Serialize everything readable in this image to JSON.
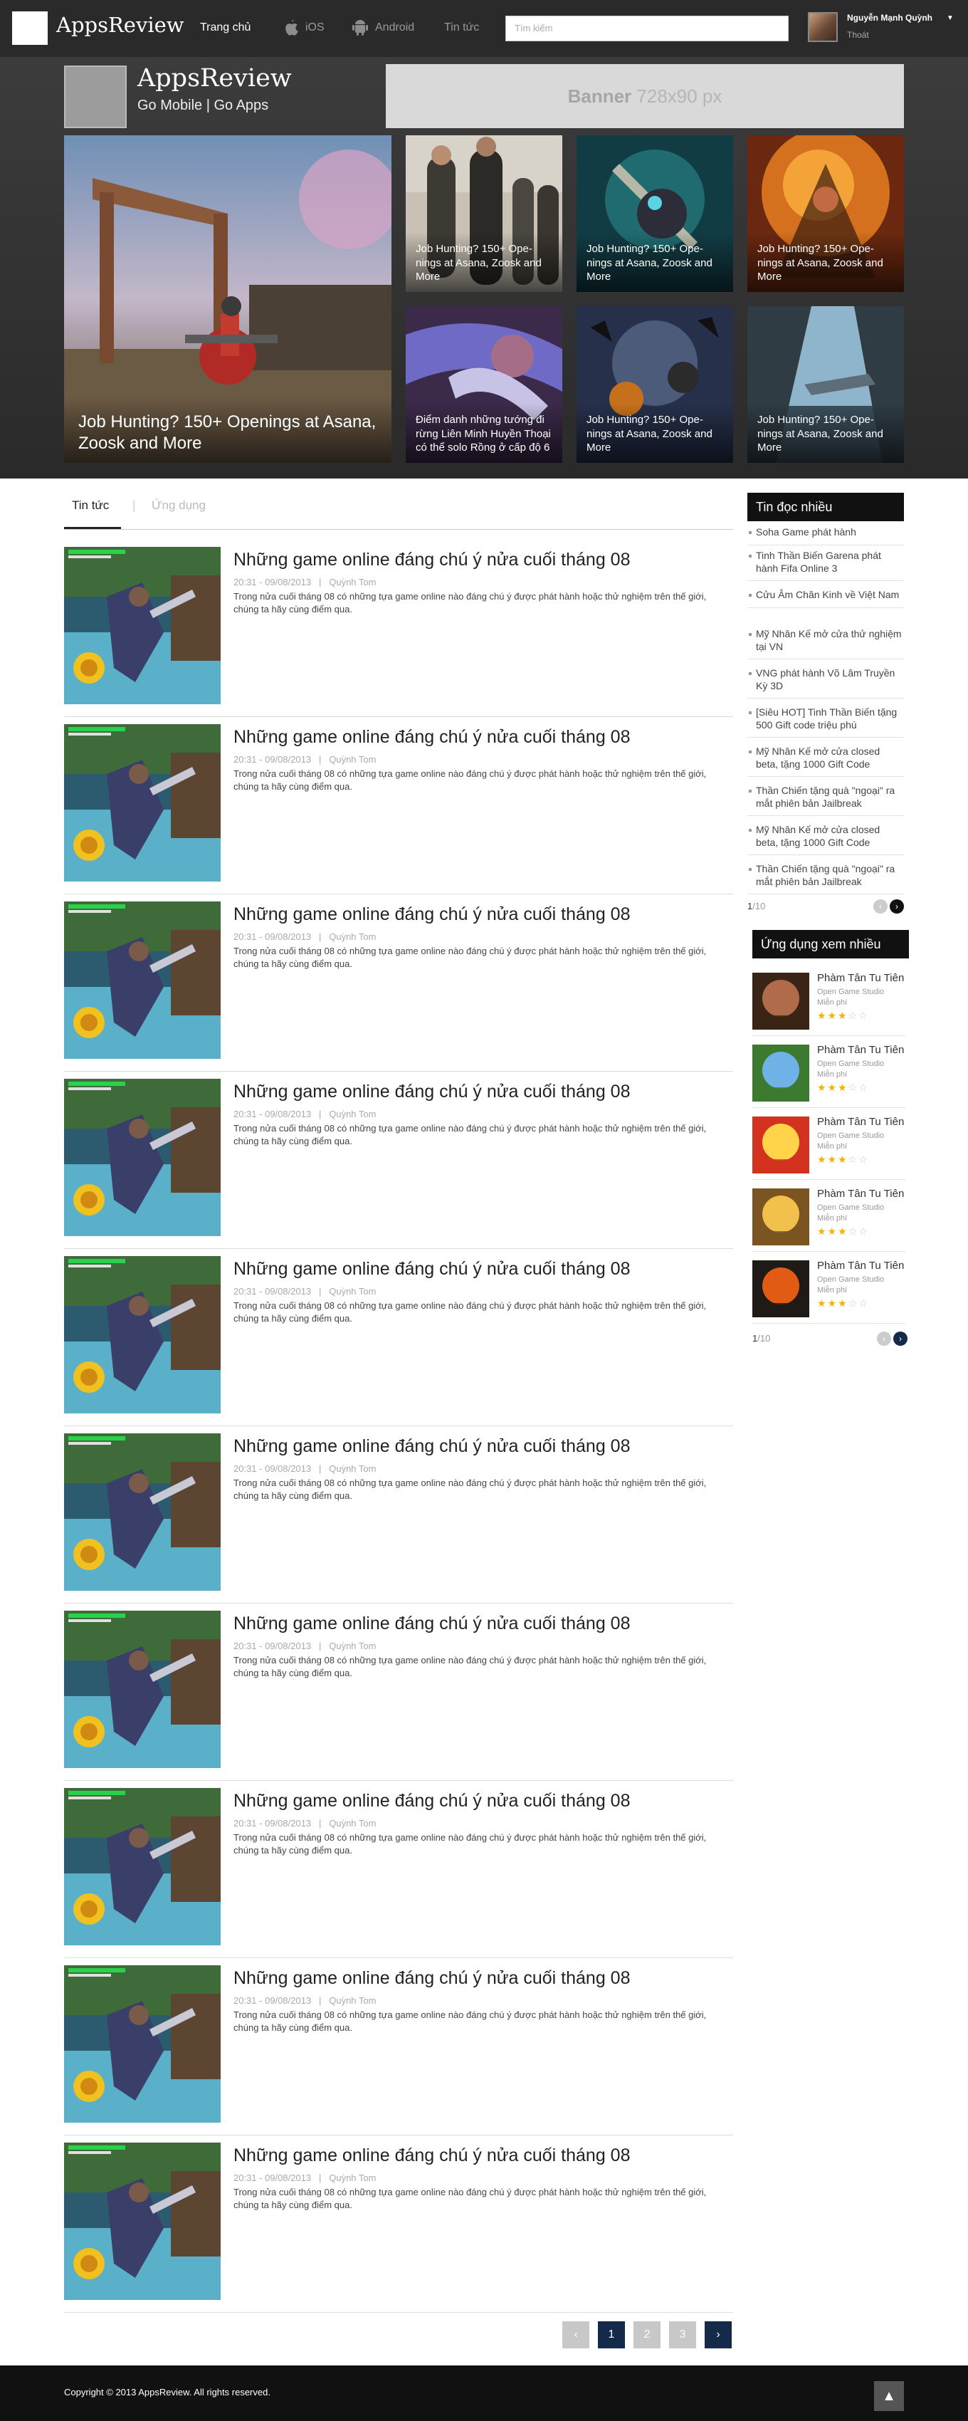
{
  "nav": {
    "logo": "AppsReview",
    "items": [
      "Trang chủ",
      "iOS",
      "Android",
      "Tin tức"
    ],
    "search_placeholder": "Tìm kiếm",
    "user_name": "Nguyễn Mạnh Quỳnh",
    "logout": "Thoát"
  },
  "hero": {
    "site_title": "AppsReview",
    "tagline": "Go Mobile | Go Apps",
    "banner_label": "Banner",
    "banner_size": "728x90 px",
    "featured_title": "Job Hunting? 150+ Openings at Asana, Zoosk and More",
    "tiles": [
      "Job Hunting? 150+ Ope-nings at Asana, Zoosk and More",
      "Job Hunting? 150+ Ope-nings at Asana, Zoosk and More",
      "Job Hunting? 150+ Ope-nings at Asana, Zoosk and More",
      "Điểm danh những tướng đi rừng Liên Minh Huyền Thoại có thể solo Rồng ở cấp độ 6",
      "Job Hunting? 150+ Ope-nings at Asana, Zoosk and More",
      "Job Hunting? 150+ Ope-nings at Asana, Zoosk and More"
    ]
  },
  "tabs": [
    "Tin tức",
    "|",
    "Ứng dụng"
  ],
  "articles": [
    {
      "title": "Những game online đáng chú ý nửa cuối tháng 08",
      "time": "20:31 - 09/08/2013",
      "sep": "|",
      "author": "Quỳnh Tom",
      "summary": "Trong nửa cuối tháng 08 có những tựa game online nào đáng chú ý được phát hành hoặc thử nghiệm trên thế giới, chúng ta hãy cùng điểm qua."
    },
    {
      "title": "Những game online đáng chú ý nửa cuối tháng 08",
      "time": "20:31 - 09/08/2013",
      "sep": "|",
      "author": "Quỳnh Tom",
      "summary": "Trong nửa cuối tháng 08 có những tựa game online nào đáng chú ý được phát hành hoặc thử nghiệm trên thế giới, chúng ta hãy cùng điểm qua."
    },
    {
      "title": "Những game online đáng chú ý nửa cuối tháng 08",
      "time": "20:31 - 09/08/2013",
      "sep": "|",
      "author": "Quỳnh Tom",
      "summary": "Trong nửa cuối tháng 08 có những tựa game online nào đáng chú ý được phát hành hoặc thử nghiệm trên thế giới, chúng ta hãy cùng điểm qua."
    },
    {
      "title": "Những game online đáng chú ý nửa cuối tháng 08",
      "time": "20:31 - 09/08/2013",
      "sep": "|",
      "author": "Quỳnh Tom",
      "summary": "Trong nửa cuối tháng 08 có những tựa game online nào đáng chú ý được phát hành hoặc thử nghiệm trên thế giới, chúng ta hãy cùng điểm qua."
    },
    {
      "title": "Những game online đáng chú ý nửa cuối tháng 08",
      "time": "20:31 - 09/08/2013",
      "sep": "|",
      "author": "Quỳnh Tom",
      "summary": "Trong nửa cuối tháng 08 có những tựa game online nào đáng chú ý được phát hành hoặc thử nghiệm trên thế giới, chúng ta hãy cùng điểm qua."
    },
    {
      "title": "Những game online đáng chú ý nửa cuối tháng 08",
      "time": "20:31 - 09/08/2013",
      "sep": "|",
      "author": "Quỳnh Tom",
      "summary": "Trong nửa cuối tháng 08 có những tựa game online nào đáng chú ý được phát hành hoặc thử nghiệm trên thế giới, chúng ta hãy cùng điểm qua."
    },
    {
      "title": "Những game online đáng chú ý nửa cuối tháng 08",
      "time": "20:31 - 09/08/2013",
      "sep": "|",
      "author": "Quỳnh Tom",
      "summary": "Trong nửa cuối tháng 08 có những tựa game online nào đáng chú ý được phát hành hoặc thử nghiệm trên thế giới, chúng ta hãy cùng điểm qua."
    },
    {
      "title": "Những game online đáng chú ý nửa cuối tháng 08",
      "time": "20:31 - 09/08/2013",
      "sep": "|",
      "author": "Quỳnh Tom",
      "summary": "Trong nửa cuối tháng 08 có những tựa game online nào đáng chú ý được phát hành hoặc thử nghiệm trên thế giới, chúng ta hãy cùng điểm qua."
    },
    {
      "title": "Những game online đáng chú ý nửa cuối tháng 08",
      "time": "20:31 - 09/08/2013",
      "sep": "|",
      "author": "Quỳnh Tom",
      "summary": "Trong nửa cuối tháng 08 có những tựa game online nào đáng chú ý được phát hành hoặc thử nghiệm trên thế giới, chúng ta hãy cùng điểm qua."
    },
    {
      "title": "Những game online đáng chú ý nửa cuối tháng 08",
      "time": "20:31 - 09/08/2013",
      "sep": "|",
      "author": "Quỳnh Tom",
      "summary": "Trong nửa cuối tháng 08 có những tựa game online nào đáng chú ý được phát hành hoặc thử nghiệm trên thế giới, chúng ta hãy cùng điểm qua."
    }
  ],
  "pagination": {
    "prev": "‹",
    "pages": [
      "1",
      "2",
      "3"
    ],
    "current": "1",
    "next": "›"
  },
  "sidebar": {
    "most_read_title": "Tin đọc nhiều",
    "most_read": [
      "Soha Game phát hành",
      "Tinh Thần Biến Garena phát hành Fifa Online 3",
      "Cửu Âm Chân Kinh về Việt Nam",
      "Mỹ Nhân Kế mở cửa thử nghiệm tại VN",
      "VNG phát hành Võ Lâm Truyền Kỳ 3D",
      "[Siêu HOT] Tinh Thần Biến tặng 500 Gift code triệu phú",
      "Mỹ Nhân Kế mở cửa closed beta, tặng 1000 Gift Code",
      "Thần Chiến tặng quà \"ngoại\" ra mắt phiên bản Jailbreak",
      "Mỹ Nhân Kế mở cửa closed beta, tặng 1000 Gift Code",
      "Thần Chiến tặng quà \"ngoại\" ra mắt phiên bản Jailbreak"
    ],
    "most_read_page": "1",
    "most_read_total": "/10",
    "apps_title": "Ứng dụng xem nhiều",
    "apps": [
      {
        "name": "Phàm Tân Tu Tiên",
        "dev": "Open Game Studio",
        "price": "Miễn phí",
        "rating": 3,
        "icon": "warrior-portrait-icon",
        "c1": "#b06b4a",
        "c2": "#3a2416"
      },
      {
        "name": "Phàm Tân Tu Tiên",
        "dev": "Open Game Studio",
        "price": "Miễn phí",
        "rating": 3,
        "icon": "ball-game-icon",
        "c1": "#6fb2e8",
        "c2": "#3c7a2f"
      },
      {
        "name": "Phàm Tân Tu Tiên",
        "dev": "Open Game Studio",
        "price": "Miễn phí",
        "rating": 3,
        "icon": "angry-birds-icon",
        "c1": "#ffd34a",
        "c2": "#d2321e"
      },
      {
        "name": "Phàm Tân Tu Tiên",
        "dev": "Open Game Studio",
        "price": "Miễn phí",
        "rating": 3,
        "icon": "cartoon-game-icon",
        "c1": "#f2c14c",
        "c2": "#7b5422"
      },
      {
        "name": "Phàm Tân Tu Tiên",
        "dev": "Open Game Studio",
        "price": "Miễn phí",
        "rating": 3,
        "icon": "ninja-game-icon",
        "c1": "#e25b14",
        "c2": "#1f1a16"
      }
    ],
    "apps_page": "1",
    "apps_total": "/10"
  },
  "footer": {
    "copyright": "Copyright © 2013 AppsReview. All rights reserved.",
    "to_top": "▲"
  },
  "colors": {
    "topbar": "#2a2a2a",
    "accent_dark": "#142a4a",
    "star": "#f0b400"
  }
}
